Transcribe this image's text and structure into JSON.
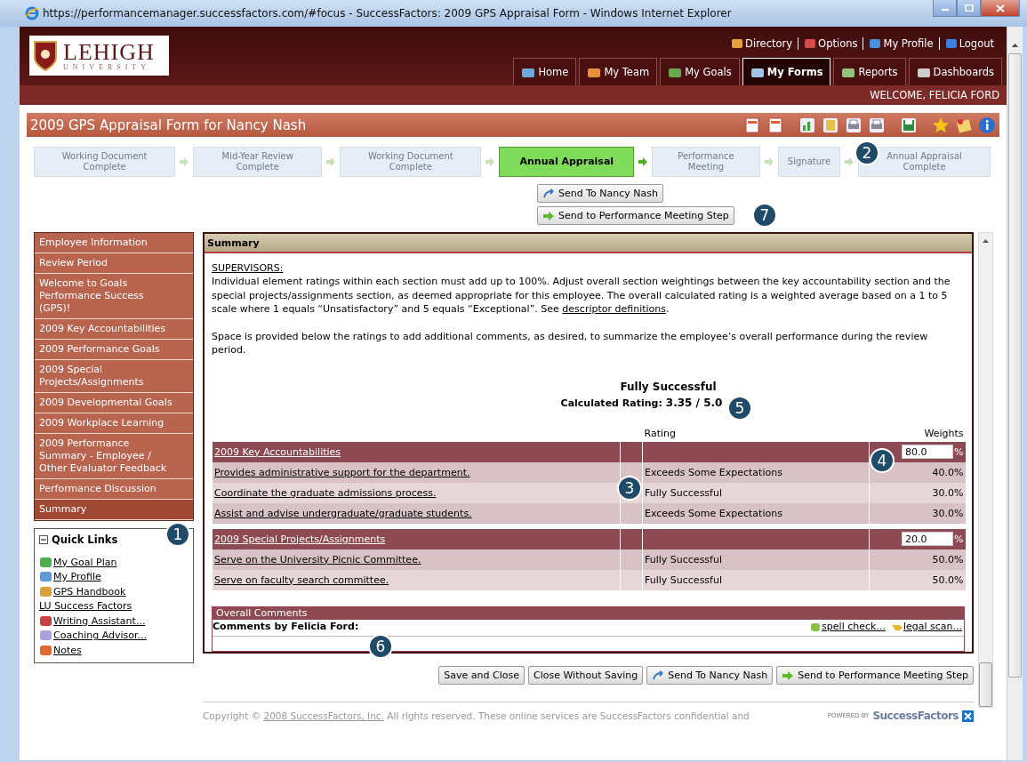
{
  "browser": {
    "title": "https://performancemanager.successfactors.com/#focus - SuccessFactors: 2009 GPS Appraisal Form  - Windows Internet Explorer"
  },
  "logo": {
    "name": "LEHIGH",
    "subtitle": "UNIVERSITY"
  },
  "top_links": [
    {
      "label": "Directory",
      "kind": "directory"
    },
    {
      "label": "Options",
      "kind": "options"
    },
    {
      "label": "My Profile",
      "kind": "profile"
    },
    {
      "label": "Logout",
      "kind": "logout"
    }
  ],
  "tabs": [
    {
      "label": "Home",
      "kind": "home",
      "selected": false
    },
    {
      "label": "My Team",
      "kind": "team",
      "selected": false
    },
    {
      "label": "My Goals",
      "kind": "goals",
      "selected": false
    },
    {
      "label": "My Forms",
      "kind": "forms",
      "selected": true
    },
    {
      "label": "Reports",
      "kind": "reports",
      "selected": false
    },
    {
      "label": "Dashboards",
      "kind": "dashboards",
      "selected": false
    }
  ],
  "welcome": "WELCOME, FELICIA FORD",
  "form_title": "2009 GPS Appraisal Form for Nancy Nash",
  "steps": [
    {
      "label": "Working Document Complete",
      "selected": false
    },
    {
      "label": "Mid-Year Review Complete",
      "selected": false
    },
    {
      "label": "Working Document Complete",
      "selected": false
    },
    {
      "label": "Annual Appraisal",
      "selected": true
    },
    {
      "label": "Performance Meeting",
      "selected": false
    },
    {
      "label": "Signature",
      "selected": false
    },
    {
      "label": "Annual Appraisal Complete",
      "selected": false
    }
  ],
  "step_buttons": [
    {
      "label": "Send To Nancy Nash",
      "kind": "send"
    },
    {
      "label": "Send to Performance Meeting Step",
      "kind": "forward"
    }
  ],
  "sidebar": {
    "items": [
      {
        "label": "Employee Information",
        "selected": false
      },
      {
        "label": "Review Period",
        "selected": false
      },
      {
        "label": "Welcome to Goals Performance Success (GPS)!",
        "selected": false
      },
      {
        "label": "2009 Key Accountabilities",
        "selected": false
      },
      {
        "label": "2009 Performance Goals",
        "selected": false
      },
      {
        "label": "2009 Special Projects/Assignments",
        "selected": false
      },
      {
        "label": "2009 Developmental Goals",
        "selected": false
      },
      {
        "label": "2009 Workplace Learning",
        "selected": false
      },
      {
        "label": "2009 Performance Summary - Employee / Other Evaluator Feedback",
        "selected": false
      },
      {
        "label": "Performance Discussion",
        "selected": false
      },
      {
        "label": "Summary",
        "selected": true
      }
    ]
  },
  "quick_links": {
    "title": "Quick Links",
    "expanded": true,
    "items": [
      {
        "label": "My Goal Plan",
        "kind": "goal"
      },
      {
        "label": "My Profile",
        "kind": "profile"
      },
      {
        "label": "GPS Handbook",
        "kind": "handbook"
      },
      {
        "label": "LU Success Factors",
        "kind": "plain"
      },
      {
        "label": "Writing Assistant...",
        "kind": "writing"
      },
      {
        "label": "Coaching Advisor...",
        "kind": "coaching"
      },
      {
        "label": "Notes",
        "kind": "notes"
      }
    ]
  },
  "summary": {
    "title": "Summary",
    "heading": "SUPERVISORS:",
    "paragraph": "Individual element ratings within each section must add up to 100%. Adjust overall section weightings between the key accountability section and the special projects/assignments section, as deemed appropriate for this employee. The overall calculated rating is a weighted average based on a 1 to 5 scale where 1 equals “Unsatisfactory” and 5 equals “Exceptional”. See ",
    "link": "descriptor definitions",
    "after": ".",
    "note": "Space is provided below the ratings to add additional comments, as desired, to summarize the employee’s overall performance during the review period.",
    "rating": "Fully Successful",
    "calculated_label": "Calculated Rating:",
    "calculated_value": "3.35 / 5.0"
  },
  "table": {
    "columns": [
      "Rating",
      "Weights"
    ],
    "sections": [
      {
        "title": "2009 Key Accountabilities",
        "weight": "80.0",
        "unit": "%",
        "rows": [
          {
            "name": "Provides administrative support for the department.",
            "rating": "Exceeds Some Expectations",
            "weight": "40.0%"
          },
          {
            "name": "Coordinate the graduate admissions process.",
            "rating": "Fully Successful",
            "weight": "30.0%"
          },
          {
            "name": "Assist and advise undergraduate/graduate students.",
            "rating": "Exceeds Some Expectations",
            "weight": "30.0%"
          }
        ]
      },
      {
        "title": "2009 Special Projects/Assignments",
        "weight": "20.0",
        "unit": "%",
        "rows": [
          {
            "name": "Serve on the University Picnic Committee.",
            "rating": "Fully Successful",
            "weight": "50.0%"
          },
          {
            "name": "Serve on faculty search committee.",
            "rating": "Fully Successful",
            "weight": "50.0%"
          }
        ]
      }
    ]
  },
  "comments": {
    "title": "Overall Comments",
    "label": "Comments by Felicia Ford:",
    "links": [
      {
        "label": "spell check...",
        "kind": "spell"
      },
      {
        "label": "legal scan...",
        "kind": "legal"
      }
    ]
  },
  "buttons": [
    {
      "label": "Save and Close",
      "kind": "plain"
    },
    {
      "label": "Close Without Saving",
      "kind": "plain"
    },
    {
      "label": "Send To Nancy Nash",
      "kind": "send"
    },
    {
      "label": "Send to Performance Meeting Step",
      "kind": "forward"
    }
  ],
  "footer": {
    "text": "Copyright © ",
    "link": "2008 SuccessFactors, Inc.",
    "after": " All rights reserved. These online services are SuccessFactors confidential and",
    "powered_by": "POWERED BY",
    "brand": "SuccessFactors"
  },
  "callouts": [
    "1",
    "2",
    "3",
    "4",
    "5",
    "6",
    "7"
  ]
}
